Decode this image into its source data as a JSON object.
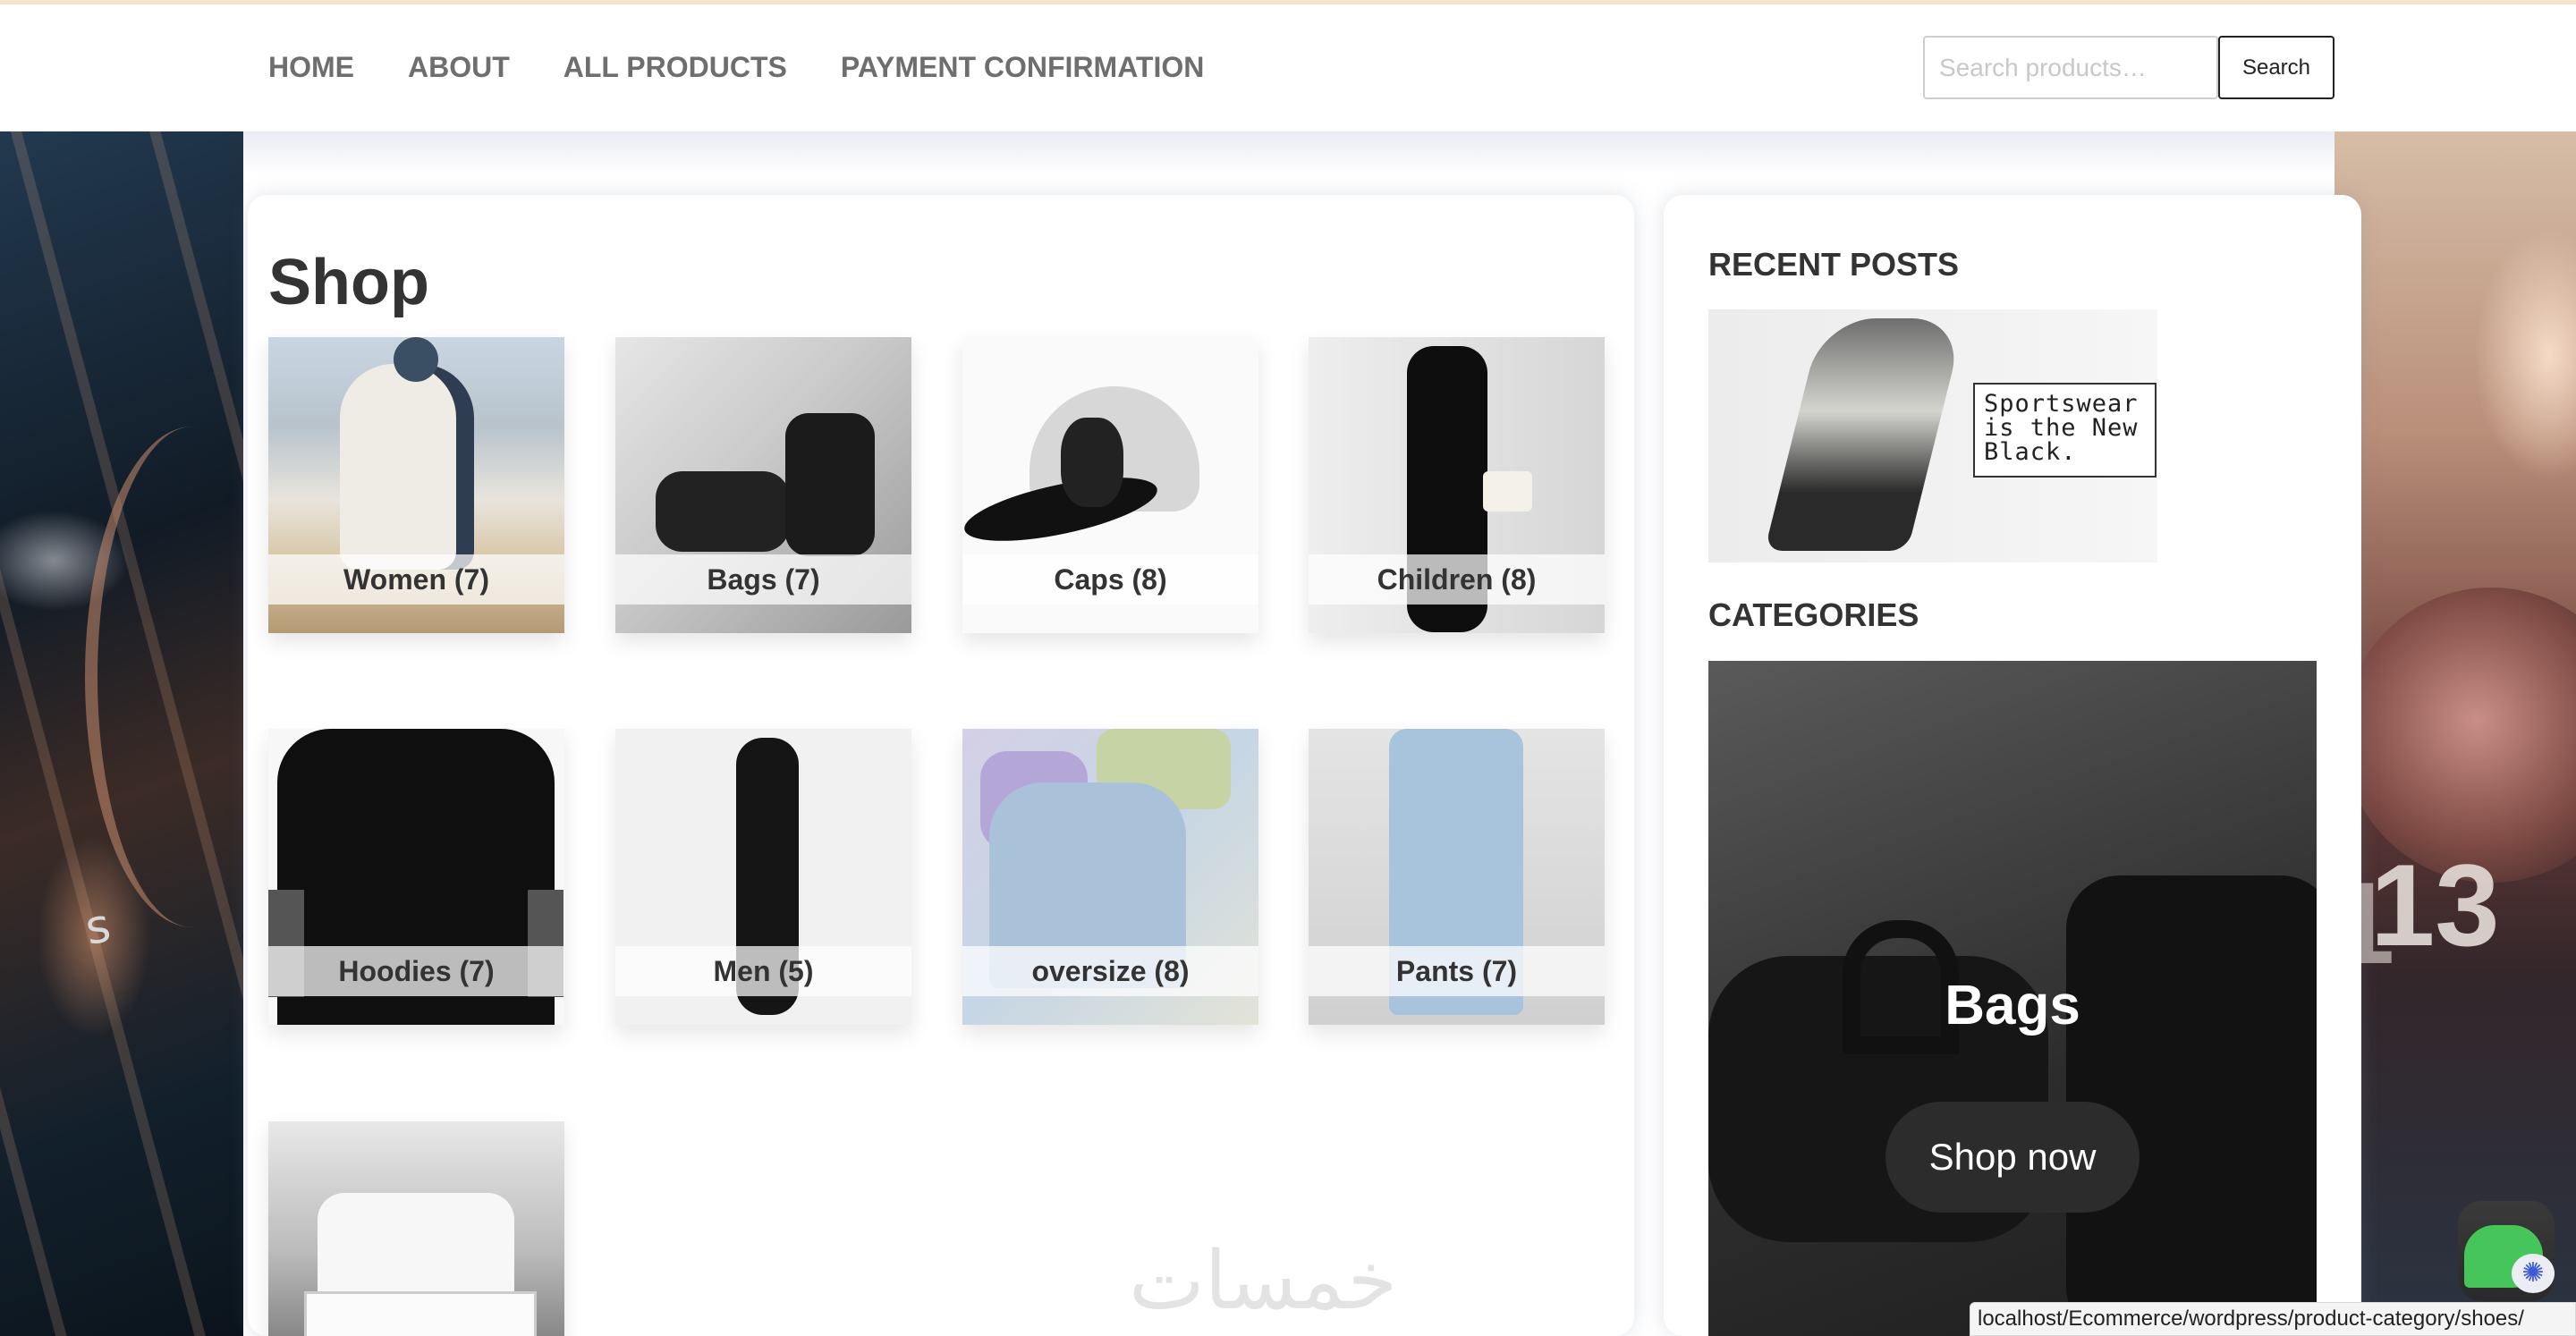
{
  "nav": {
    "items": [
      {
        "label": "HOME"
      },
      {
        "label": "ABOUT"
      },
      {
        "label": "ALL PRODUCTS"
      },
      {
        "label": "PAYMENT CONFIRMATION"
      }
    ]
  },
  "search": {
    "placeholder": "Search products…",
    "button_label": "Search"
  },
  "main": {
    "title": "Shop",
    "categories": [
      {
        "label": "Women (7)"
      },
      {
        "label": "Bags (7)"
      },
      {
        "label": "Caps (8)"
      },
      {
        "label": "Children (8)"
      },
      {
        "label": "Hoodies (7)"
      },
      {
        "label": "Men (5)"
      },
      {
        "label": "oversize (8)"
      },
      {
        "label": "Pants (7)"
      }
    ],
    "watermark": "خمسات"
  },
  "sidebar": {
    "recent_posts_heading": "RECENT POSTS",
    "post_image_text": [
      "Sportswear",
      "is the New",
      "Black."
    ],
    "categories_heading": "CATEGORIES",
    "banner_title": "Bags",
    "banner_button": "Shop now"
  },
  "status_bar": {
    "url": "localhost/Ecommerce/wordpress/product-category/shoes/"
  },
  "background_glyphs": {
    "left": "s",
    "right": "13"
  },
  "colors": {
    "nav_text": "#6e6e6e",
    "heading": "#333333",
    "whatsapp_green": "#46c65a",
    "banner_button": "#2c2c2c"
  },
  "icons": {
    "chat": "whatsapp-icon",
    "assistant": "brain-icon"
  }
}
